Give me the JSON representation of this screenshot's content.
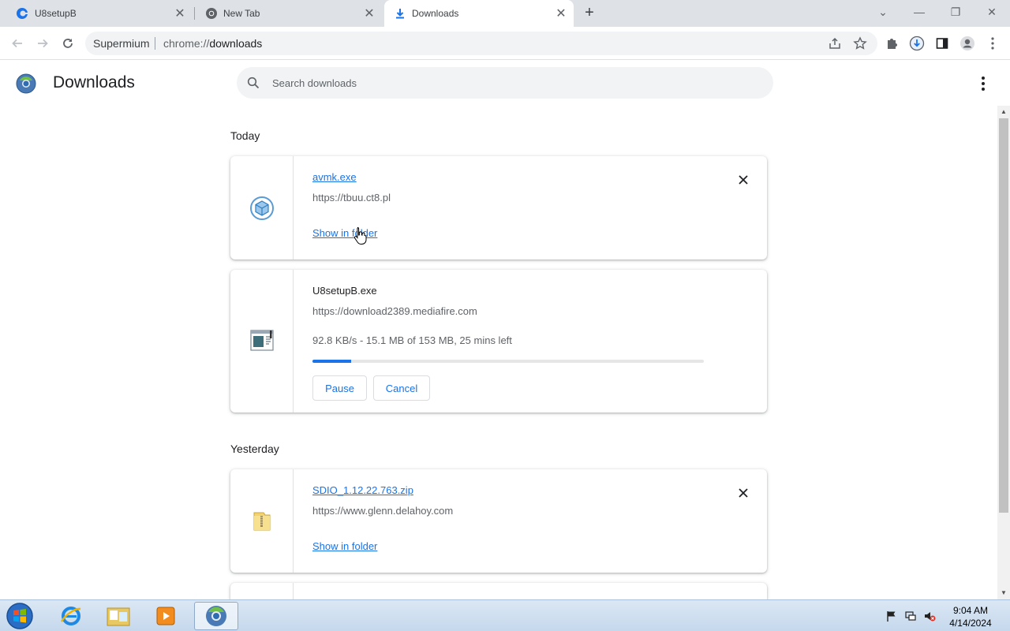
{
  "tabs": [
    {
      "title": "U8setupB",
      "icon": "edge-like-icon",
      "active": false
    },
    {
      "title": "New Tab",
      "icon": "chromium-icon",
      "active": false
    },
    {
      "title": "Downloads",
      "icon": "download-icon",
      "active": true
    }
  ],
  "omnibox": {
    "site": "Supermium",
    "url_prefix": "chrome://",
    "url_host": "downloads"
  },
  "page": {
    "title": "Downloads",
    "search_placeholder": "Search downloads"
  },
  "groups": [
    {
      "label": "Today"
    },
    {
      "label": "Yesterday"
    }
  ],
  "downloads": [
    {
      "name": "avmk.exe",
      "url": "https://tbuu.ct8.pl",
      "action": "Show in folder",
      "icon": "package-icon",
      "status": "complete"
    },
    {
      "name": "U8setupB.exe",
      "url": "https://download2389.mediafire.com",
      "progress_text": "92.8 KB/s - 15.1 MB of 153 MB, 25 mins left",
      "progress_fraction": 0.099,
      "pause_label": "Pause",
      "cancel_label": "Cancel",
      "icon": "installer-window-icon",
      "status": "in_progress"
    },
    {
      "name": "SDIO_1.12.22.763.zip",
      "url": "https://www.glenn.delahoy.com",
      "action": "Show in folder",
      "icon": "zip-folder-icon",
      "status": "complete"
    }
  ],
  "taskbar": {
    "time": "9:04 AM",
    "date": "4/14/2024"
  },
  "colors": {
    "accent": "#1a73e8",
    "tabstrip": "#dee1e6"
  }
}
